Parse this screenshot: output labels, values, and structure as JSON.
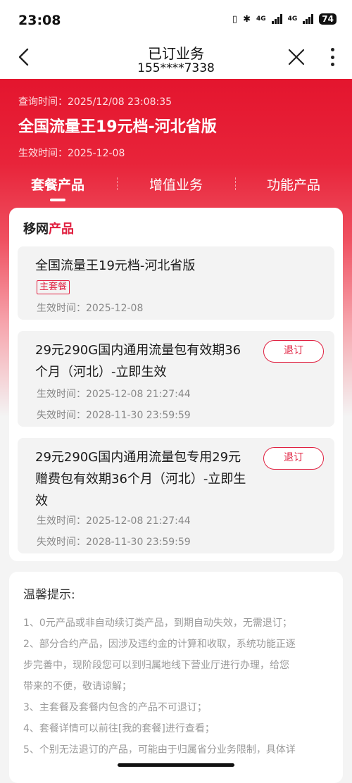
{
  "status_bar": {
    "time": "23:08",
    "net1": "4G",
    "net2": "4G",
    "battery": "74"
  },
  "nav": {
    "title": "已订业务",
    "phone": "155****7338"
  },
  "header": {
    "query_time": "查询时间：2025/12/08 23:08:35",
    "plan_name": "全国流量王19元档-河北省版",
    "effective": "生效时间：2025-12-08"
  },
  "tabs": [
    {
      "label": "套餐产品"
    },
    {
      "label": "增值业务"
    },
    {
      "label": "功能产品"
    }
  ],
  "section": {
    "title_a": "移网",
    "title_b": "产品"
  },
  "items": [
    {
      "name": "全国流量王19元档-河北省版",
      "tag": "主套餐",
      "effective": "生效时间：2025-12-08"
    },
    {
      "name_lines": [
        "29元290G国内通用流量包有效期36",
        "个月（河北）-立即生效"
      ],
      "effective": "生效时间：2025-12-08 21:27:44",
      "expire": "失效时间：2028-11-30 23:59:59",
      "button": "退订"
    },
    {
      "name_lines": [
        "29元290G国内通用流量包专用29元",
        "赠费包有效期36个月（河北）-立即生",
        "效"
      ],
      "effective": "生效时间：2025-12-08 21:27:44",
      "expire": "失效时间：2028-11-30 23:59:59",
      "button": "退订"
    }
  ],
  "tips": {
    "title": "温馨提示:",
    "lines": [
      "1、0元产品或非自动续订类产品，到期自动失效，无需退订；",
      "2、部分合约产品，因涉及违约金的计算和收取，系统功能正逐",
      "步完善中，现阶段您可以到归属地线下营业厅进行办理，给您",
      "带来的不便，敬请谅解；",
      "3、主套餐及套餐内包含的产品不可退订；",
      "4、套餐详情可以前往[我的套餐]进行查看；",
      "5、个别无法退订的产品，可能由于归属省分业务限制，具体详"
    ]
  },
  "colors": {
    "brand_red": "#e4152e",
    "accent": "#e02040"
  }
}
